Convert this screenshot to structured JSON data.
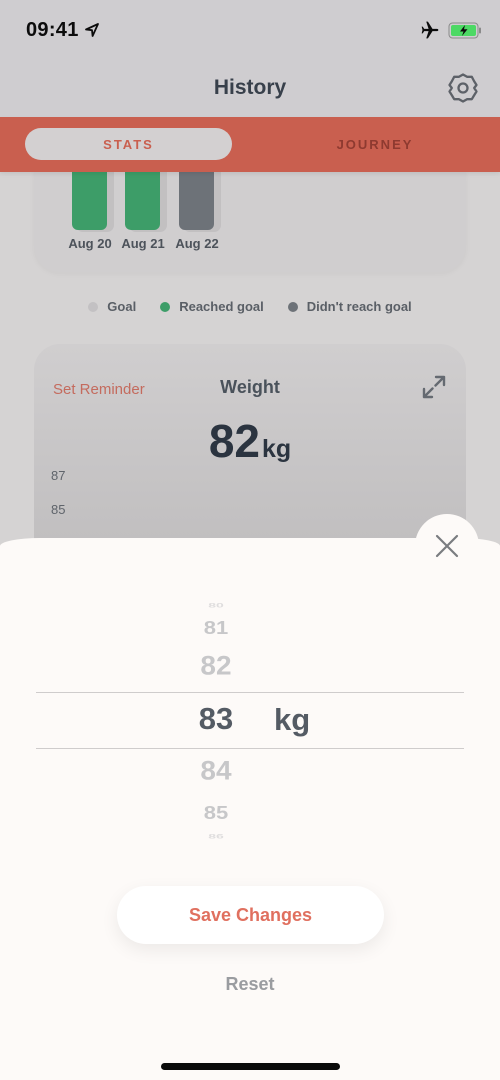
{
  "status_bar": {
    "time": "09:41",
    "icons": [
      "location-arrow-icon",
      "airplane-icon",
      "battery-charging-icon"
    ],
    "battery_color": "#4cd964"
  },
  "header": {
    "title": "History",
    "settings_icon": "gear-icon"
  },
  "tabs": [
    {
      "label": "STATS",
      "selected": true
    },
    {
      "label": "JOURNEY",
      "selected": false
    }
  ],
  "goal_chart": {
    "bars": [
      {
        "label": "Aug 20",
        "status": "reached"
      },
      {
        "label": "Aug 21",
        "status": "reached"
      },
      {
        "label": "Aug 22",
        "status": "not_reached"
      }
    ],
    "legend": [
      {
        "label": "Goal",
        "color": "#c3c1c3"
      },
      {
        "label": "Reached goal",
        "color": "#3d9d68"
      },
      {
        "label": "Didn't reach goal",
        "color": "#6d7278"
      }
    ]
  },
  "weight_card": {
    "reminder_link": "Set Reminder",
    "title": "Weight",
    "value": "82",
    "unit": "kg",
    "y_ticks": [
      "87",
      "85"
    ]
  },
  "weight_picker": {
    "options": [
      "80",
      "81",
      "82",
      "83",
      "84",
      "85",
      "86"
    ],
    "selected": "83",
    "unit": "kg"
  },
  "actions": {
    "save_label": "Save Changes",
    "reset_label": "Reset"
  },
  "colors": {
    "accent": "#c95f4f",
    "save_text": "#e0705f",
    "sheet_bg": "#fdfaf8"
  }
}
